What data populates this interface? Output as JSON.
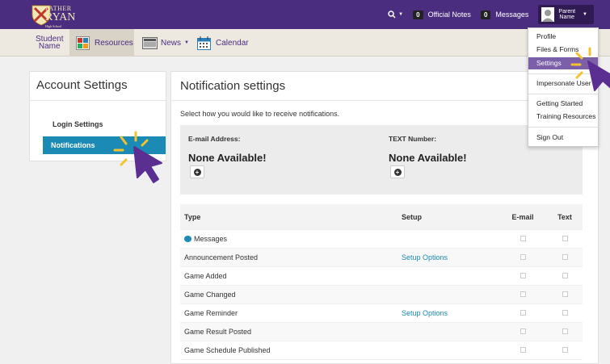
{
  "header": {
    "logo": {
      "line1": "FATHER",
      "line2": "RYAN",
      "line3": "High School"
    },
    "official_notes_count": "0",
    "official_notes_label": "Official Notes",
    "messages_count": "0",
    "messages_label": "Messages",
    "user_line1": "Parent",
    "user_line2": "Name"
  },
  "nav": {
    "student_line1": "Student",
    "student_line2": "Name",
    "resources": "Resources",
    "news": "News",
    "calendar": "Calendar"
  },
  "left_panel": {
    "title": "Account Settings",
    "items": [
      "Login Settings",
      "Notifications"
    ]
  },
  "main": {
    "title": "Notification settings",
    "subtitle": "Select how you would like to receive notifications.",
    "email_label": "E-mail Address:",
    "email_value": "None Available!",
    "text_label": "TEXT Number:",
    "text_value": "None Available!",
    "table": {
      "headers": [
        "Type",
        "Setup",
        "E-mail",
        "Text"
      ],
      "rows": [
        {
          "type": "Messages",
          "setup": ""
        },
        {
          "type": "Announcement Posted",
          "setup": "Setup Options"
        },
        {
          "type": "Game Added",
          "setup": ""
        },
        {
          "type": "Game Changed",
          "setup": ""
        },
        {
          "type": "Game Reminder",
          "setup": "Setup Options"
        },
        {
          "type": "Game Result Posted",
          "setup": ""
        },
        {
          "type": "Game Schedule Published",
          "setup": ""
        }
      ]
    }
  },
  "dropdown": {
    "items": [
      "Profile",
      "Files & Forms",
      "Settings",
      "Impersonate User",
      "Getting Started",
      "Training Resources",
      "Sign Out"
    ],
    "active": "Settings"
  },
  "colors": {
    "brand_purple": "#4b2d7f",
    "accent_blue": "#1b8bb5",
    "highlight_yellow": "#f5c12e",
    "cursor_purple": "#5b2e91"
  }
}
